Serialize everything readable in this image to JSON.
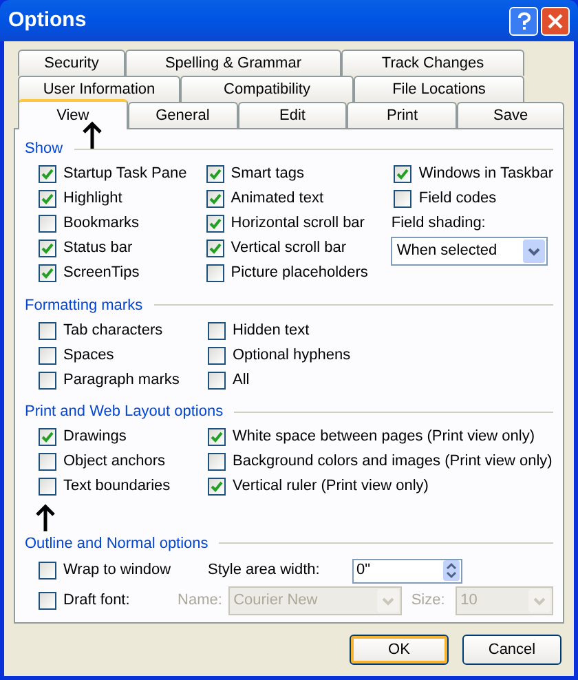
{
  "window": {
    "title": "Options"
  },
  "tab_rows": [
    [
      {
        "label": "Security",
        "selected": false
      },
      {
        "label": "Spelling & Grammar",
        "selected": false
      },
      {
        "label": "Track Changes",
        "selected": false
      }
    ],
    [
      {
        "label": "User Information",
        "selected": false
      },
      {
        "label": "Compatibility",
        "selected": false
      },
      {
        "label": "File Locations",
        "selected": false
      }
    ],
    [
      {
        "label": "View",
        "selected": true
      },
      {
        "label": "General",
        "selected": false
      },
      {
        "label": "Edit",
        "selected": false
      },
      {
        "label": "Print",
        "selected": false
      },
      {
        "label": "Save",
        "selected": false
      }
    ]
  ],
  "show": {
    "heading": "Show",
    "columns": [
      [
        {
          "label": "Startup Task Pane",
          "checked": true
        },
        {
          "label": "Highlight",
          "checked": true
        },
        {
          "label": "Bookmarks",
          "checked": false
        },
        {
          "label": "Status bar",
          "checked": true
        },
        {
          "label": "ScreenTips",
          "checked": true
        }
      ],
      [
        {
          "label": "Smart tags",
          "checked": true
        },
        {
          "label": "Animated text",
          "checked": true
        },
        {
          "label": "Horizontal scroll bar",
          "checked": true
        },
        {
          "label": "Vertical scroll bar",
          "checked": true
        },
        {
          "label": "Picture placeholders",
          "checked": false
        }
      ],
      [
        {
          "label": "Windows in Taskbar",
          "checked": true
        },
        {
          "label": "Field codes",
          "checked": false
        }
      ]
    ],
    "field_shading": {
      "label": "Field shading:",
      "value": "When selected"
    }
  },
  "formatting_marks": {
    "heading": "Formatting marks",
    "columns": [
      [
        {
          "label": "Tab characters",
          "checked": false
        },
        {
          "label": "Spaces",
          "checked": false
        },
        {
          "label": "Paragraph marks",
          "checked": false
        }
      ],
      [
        {
          "label": "Hidden text",
          "checked": false
        },
        {
          "label": "Optional hyphens",
          "checked": false
        },
        {
          "label": "All",
          "checked": false
        }
      ]
    ]
  },
  "print_web_layout": {
    "heading": "Print and Web Layout options",
    "columns": [
      [
        {
          "label": "Drawings",
          "checked": true
        },
        {
          "label": "Object anchors",
          "checked": false
        },
        {
          "label": "Text boundaries",
          "checked": false
        }
      ],
      [
        {
          "label": "White space between pages (Print view only)",
          "checked": true
        },
        {
          "label": "Background colors and images (Print view only)",
          "checked": false
        },
        {
          "label": "Vertical ruler (Print view only)",
          "checked": true
        }
      ]
    ]
  },
  "outline_normal": {
    "heading": "Outline and Normal options",
    "wrap_to_window": {
      "label": "Wrap to window",
      "checked": false
    },
    "style_area_width": {
      "label": "Style area width:",
      "value": "0\""
    },
    "draft_font": {
      "label": "Draft font:",
      "checked": false
    },
    "name": {
      "label": "Name:",
      "value": "Courier New",
      "disabled": true
    },
    "size": {
      "label": "Size:",
      "value": "10",
      "disabled": true
    }
  },
  "buttons": [
    {
      "label": "OK",
      "default": true
    },
    {
      "label": "Cancel",
      "default": false
    }
  ]
}
